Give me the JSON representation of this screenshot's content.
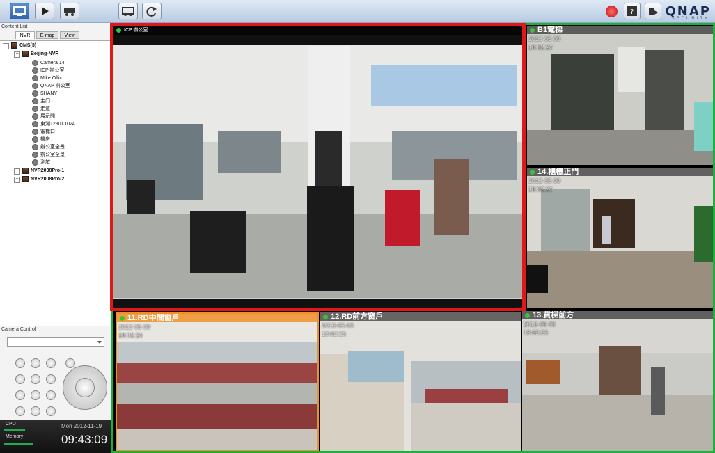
{
  "toolbar": {
    "logo": "QNAP",
    "logo_sub": "SECURITY",
    "icons": [
      "monitor-icon",
      "play-icon",
      "camera-icon",
      "layout-icon",
      "refresh-icon",
      "alert-icon",
      "help-icon",
      "logout-icon"
    ]
  },
  "left_panel": {
    "title": "Content List",
    "tabs": [
      "NVR",
      "E-map",
      "View"
    ],
    "tree": {
      "root": "CMS(3)",
      "group": "Beijing-NVR",
      "cameras": [
        "Camera 14",
        "ICP 辦公室",
        "Mike Offic",
        "QNAP 辦公室",
        "SHANY",
        "主门",
        "走道",
        "展示間",
        "東湖1280X1024",
        "電梯口",
        "機房",
        "辦公室全景",
        "辦公室全景",
        "測試"
      ],
      "others": [
        "NVR2008Pro-1",
        "NVR2008Pro-2"
      ]
    },
    "camera_control_title": "Camera Control"
  },
  "status": {
    "cpu_label": "CPU",
    "memory_label": "Memory",
    "date": "Mon  2012-11-19",
    "time": "09:43:09"
  },
  "tiles": {
    "main": {
      "title": "ICP 辦公室"
    },
    "b1": {
      "title": "B1電梯",
      "date": "2013-05-09",
      "time": "18:02:26"
    },
    "t14": {
      "title": "14.櫃檯正門",
      "date": "2013-05-09",
      "time": "18:02:26"
    },
    "t13": {
      "title": "13.貨梯前方",
      "date": "2013-05-09",
      "time": "18:02:26"
    },
    "t11": {
      "title": "11.RD中間窗戶",
      "date": "2013-05-09",
      "time": "18:02:26"
    },
    "t12": {
      "title": "12.RD前方窗戶",
      "date": "2013-05-09",
      "time": "18:02:26"
    }
  },
  "colors": {
    "selected_border": "#e01818",
    "group_border": "#18b23c",
    "orange_head": "#f0902a"
  }
}
